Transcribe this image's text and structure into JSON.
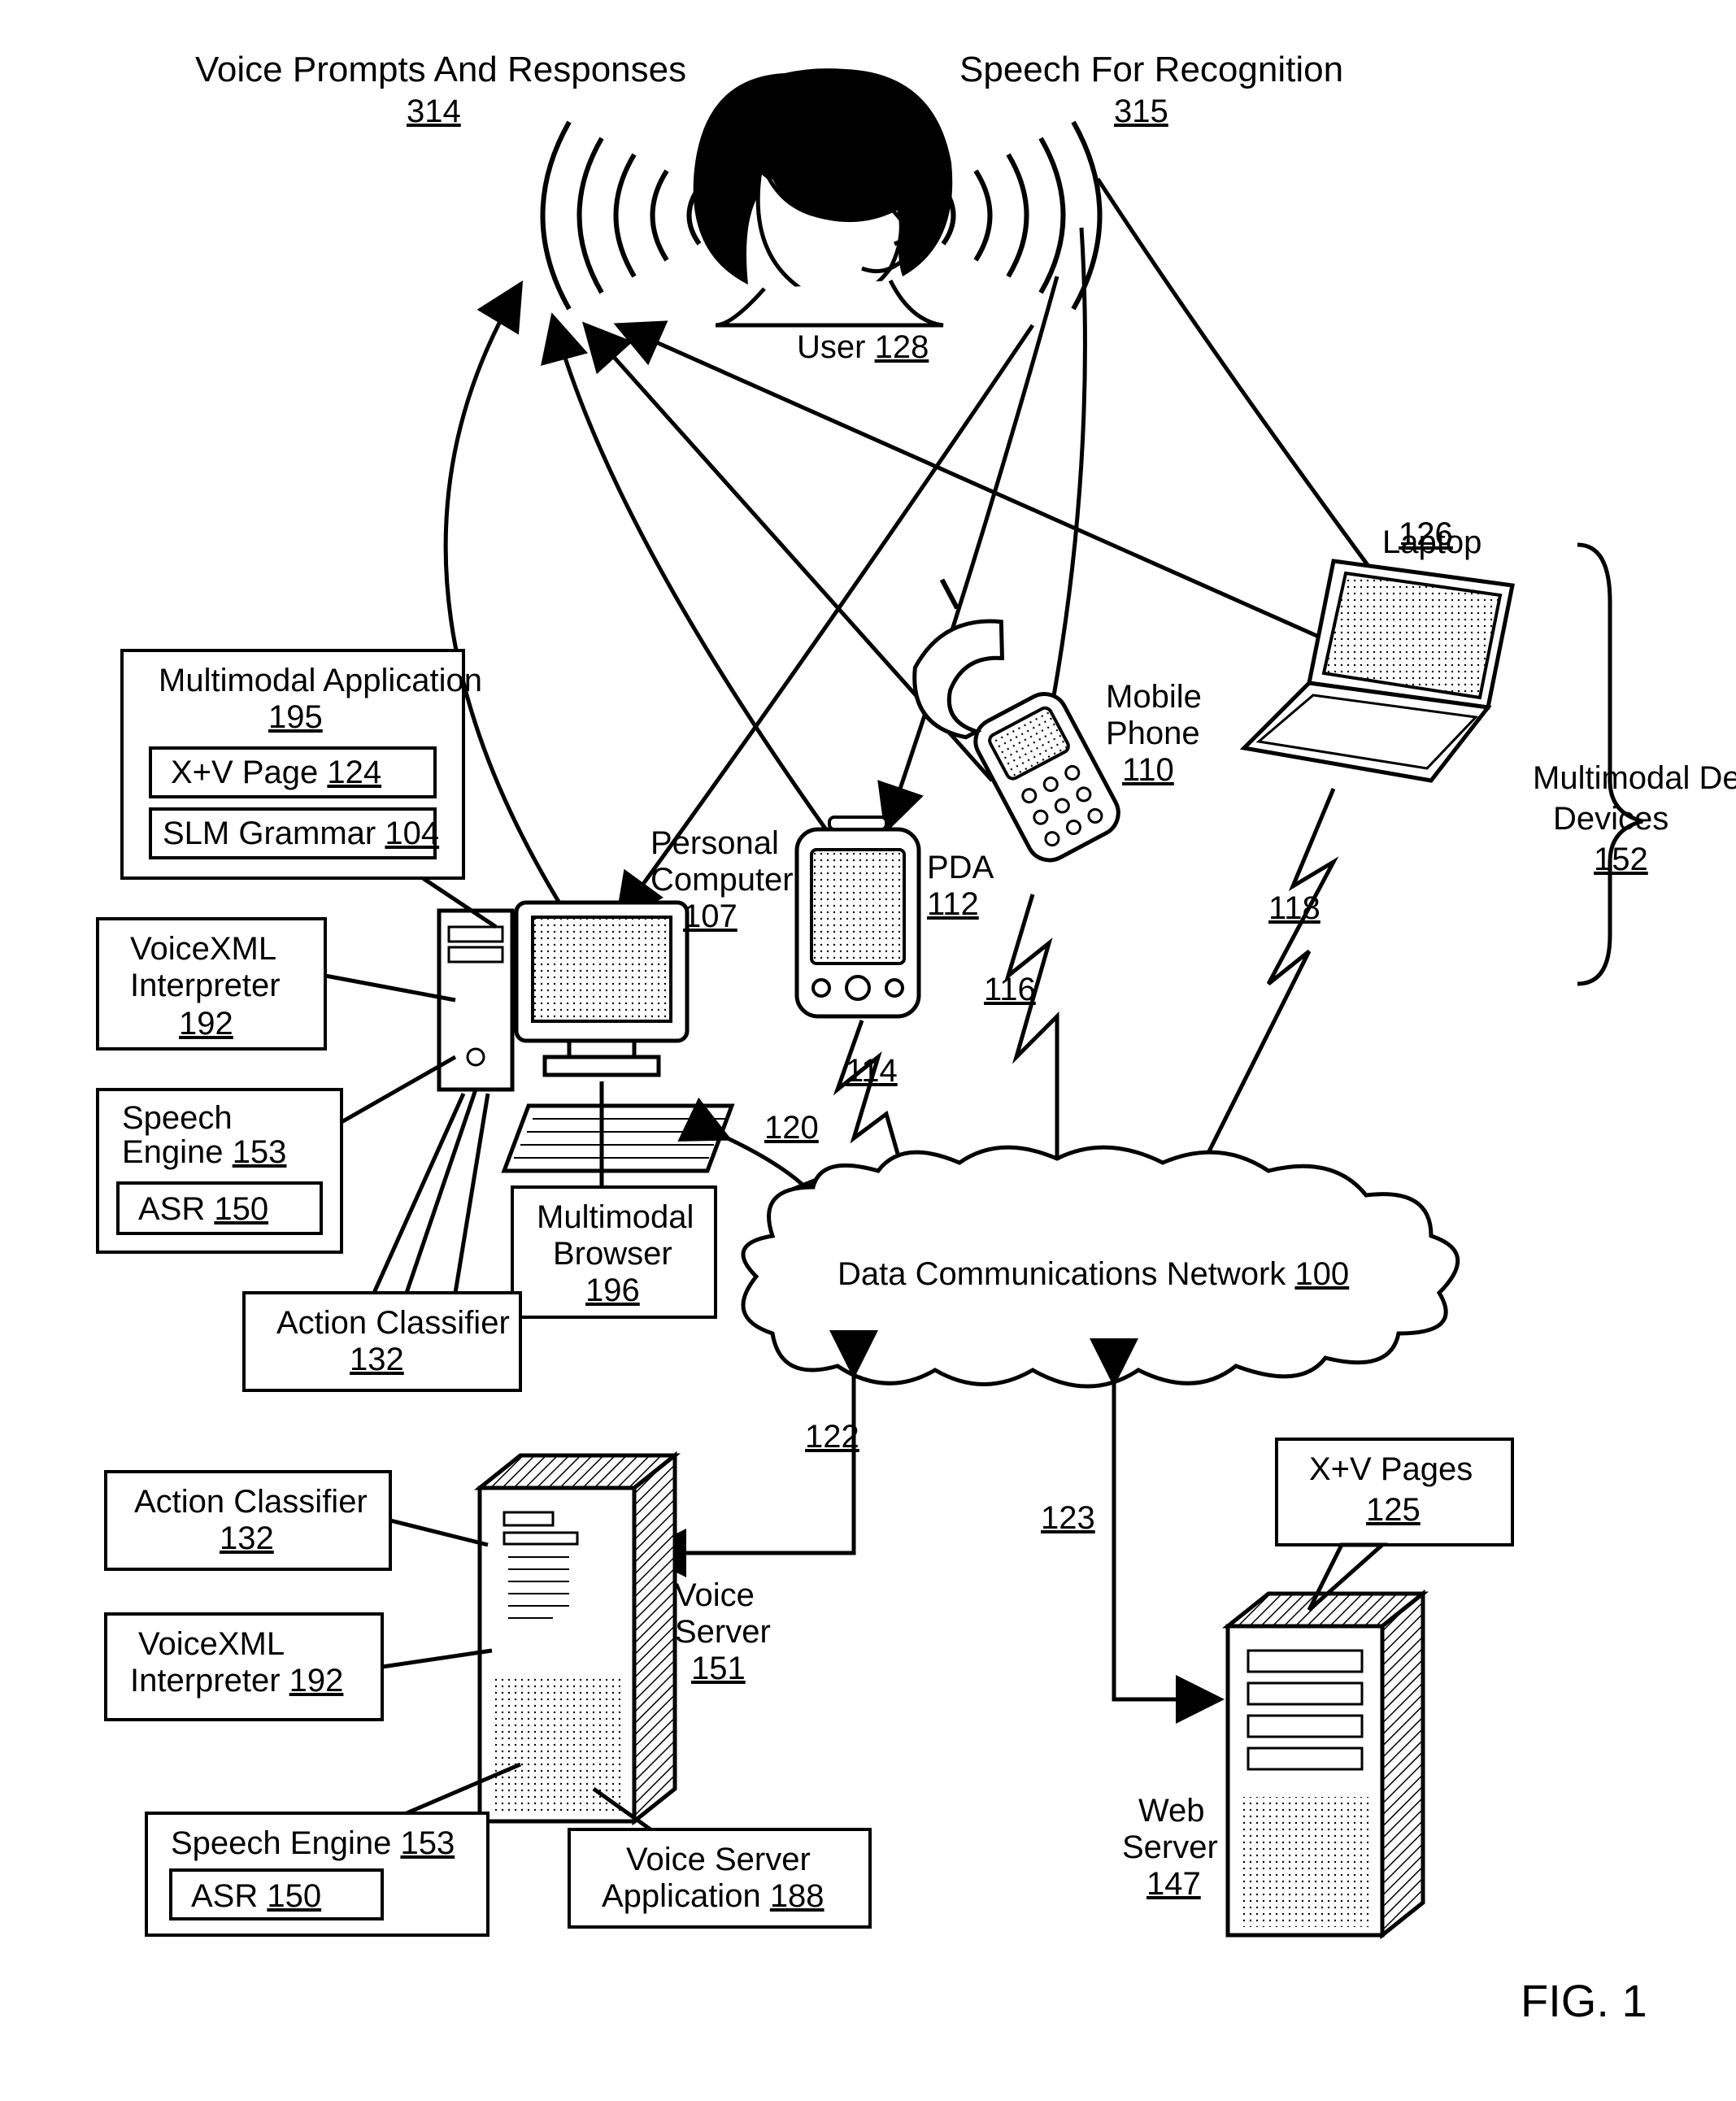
{
  "figure": "FIG. 1",
  "top": {
    "prompts_label": "Voice Prompts And Responses",
    "prompts_ref": "314",
    "recog_label": "Speech For Recognition",
    "recog_ref": "315",
    "user_label": "User",
    "user_ref": "128"
  },
  "devices_group": {
    "label": "Multimodal Devices",
    "ref": "152"
  },
  "laptop": {
    "label": "Laptop",
    "ref": "126",
    "link_ref": "118"
  },
  "mobile": {
    "label1": "Mobile",
    "label2": "Phone",
    "ref": "110",
    "link_ref": "116"
  },
  "pda": {
    "label": "PDA",
    "ref": "112",
    "link_ref": "114"
  },
  "pc": {
    "label1": "Personal",
    "label2": "Computer",
    "ref": "107",
    "link_ref": "120"
  },
  "multibrowser": {
    "label1": "Multimodal",
    "label2": "Browser",
    "ref": "196"
  },
  "mm_app": {
    "title": "Multimodal Application",
    "title_ref": "195",
    "xv_label": "X+V Page",
    "xv_ref": "124",
    "slm_label": "SLM Grammar",
    "slm_ref": "104"
  },
  "vxml_int": {
    "label1": "VoiceXML",
    "label2": "Interpreter",
    "ref": "192"
  },
  "speech_engine": {
    "label": "Speech",
    "label2": "Engine",
    "ref": "153",
    "asr_label": "ASR",
    "asr_ref": "150"
  },
  "action_classifier": {
    "label": "Action Classifier",
    "ref": "132"
  },
  "network": {
    "label": "Data Communications Network",
    "ref": "100",
    "left_link": "122",
    "right_link": "123"
  },
  "voice_server": {
    "label1": "Voice",
    "label2": "Server",
    "ref": "151",
    "pointer_ac": {
      "label": "Action Classifier",
      "ref": "132"
    },
    "pointer_vxml": {
      "label1": "VoiceXML",
      "label2": "Interpreter",
      "ref": "192"
    },
    "pointer_se": {
      "label": "Speech Engine",
      "ref": "153",
      "asr_label": "ASR",
      "asr_ref": "150"
    },
    "pointer_app": {
      "label1": "Voice Server",
      "label2": "Application",
      "ref": "188"
    }
  },
  "web_server": {
    "label1": "Web",
    "label2": "Server",
    "ref": "147"
  },
  "xv_pages": {
    "label": "X+V Pages",
    "ref": "125"
  }
}
